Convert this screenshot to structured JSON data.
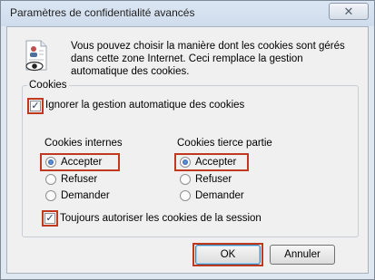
{
  "window": {
    "title": "Paramètres de confidentialité avancés",
    "close_symbol": "✕"
  },
  "info": {
    "text": "Vous pouvez choisir la manière dont les cookies sont gérés dans cette zone Internet. Ceci remplace la gestion automatique des cookies."
  },
  "cookies_group": {
    "label": "Cookies",
    "override_label": "Ignorer la gestion automatique des cookies",
    "override_checked": true,
    "first_party": {
      "heading": "Cookies internes",
      "options": [
        "Accepter",
        "Refuser",
        "Demander"
      ],
      "selected": "Accepter"
    },
    "third_party": {
      "heading": "Cookies tierce partie",
      "options": [
        "Accepter",
        "Refuser",
        "Demander"
      ],
      "selected": "Accepter"
    },
    "session_label": "Toujours autoriser les cookies de la session",
    "session_checked": true
  },
  "buttons": {
    "ok": "OK",
    "cancel": "Annuler"
  },
  "colors": {
    "highlight": "#c0391f",
    "radio_dot": "#1d4f9c"
  },
  "icons": {
    "info": "privacy-document-eye-icon",
    "close": "close-icon",
    "check": "check-icon"
  }
}
